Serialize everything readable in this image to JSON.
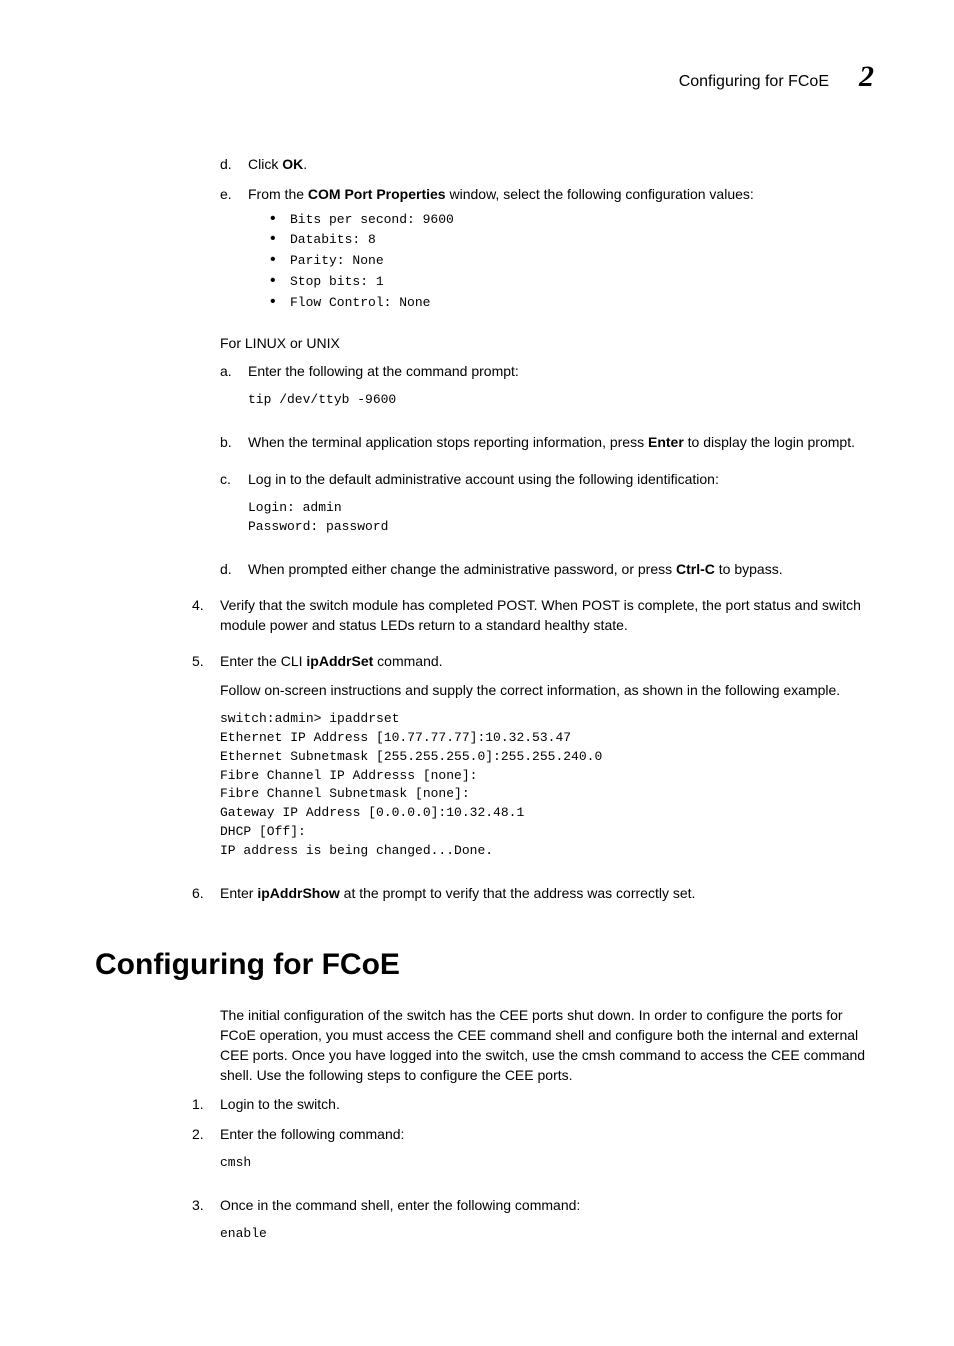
{
  "header": {
    "title": "Configuring for FCoE",
    "chapter": "2"
  },
  "sectionA": {
    "d_prefix": "d.",
    "d_text1": "Click ",
    "d_bold": "OK",
    "d_text2": ".",
    "e_prefix": "e.",
    "e_text1": "From the ",
    "e_bold": "COM Port Properties",
    "e_text2": " window, select the following configuration values:",
    "bullets": [
      "Bits per second: 9600",
      "Databits: 8",
      "Parity: None",
      "Stop bits: 1",
      "Flow Control: None"
    ],
    "linux_label": "For LINUX or UNIX",
    "a_prefix": "a.",
    "a_text": "Enter the following at the command prompt:",
    "a_code": "tip /dev/ttyb -9600",
    "b_prefix": "b.",
    "b_text1": "When the terminal application stops reporting information, press ",
    "b_bold": "Enter",
    "b_text2": " to display the login prompt.",
    "c_prefix": "c.",
    "c_text": "Log in to the default administrative account using the following identification:",
    "c_code": "Login: admin\nPassword: password",
    "d2_prefix": "d.",
    "d2_text1": "When prompted either change the administrative password, or press ",
    "d2_bold": "Ctrl-C",
    "d2_text2": " to bypass.",
    "s4_prefix": "4.",
    "s4_text": "Verify that the switch module has completed POST. When POST is complete, the port status and switch module power and status LEDs return to a standard healthy state.",
    "s5_prefix": "5.",
    "s5_text1": "Enter the CLI ",
    "s5_bold": "ipAddrSet",
    "s5_text2": " command.",
    "s5_follow": "Follow on-screen instructions and supply the correct information, as shown in the following example.",
    "s5_code": "switch:admin> ipaddrset\nEthernet IP Address [10.77.77.77]:10.32.53.47\nEthernet Subnetmask [255.255.255.0]:255.255.240.0\nFibre Channel IP Addresss [none]:\nFibre Channel Subnetmask [none]:\nGateway IP Address [0.0.0.0]:10.32.48.1\nDHCP [Off]:\nIP address is being changed...Done.",
    "s6_prefix": "6.",
    "s6_text1": "Enter ",
    "s6_bold": "ipAddrShow",
    "s6_text2": " at the prompt to verify that the address was correctly set."
  },
  "sectionB": {
    "heading": "Configuring for FCoE",
    "intro": "The initial configuration of the switch has the CEE ports shut down. In order to configure the ports for FCoE operation, you must access the CEE command shell and configure both the internal and external CEE ports. Once you have logged into the switch, use the cmsh command to access the CEE command shell. Use the following steps to configure the CEE ports.",
    "s1_prefix": "1.",
    "s1_text": "Login to the switch.",
    "s2_prefix": "2.",
    "s2_text": "Enter the following command:",
    "s2_code": "cmsh",
    "s3_prefix": "3.",
    "s3_text": "Once in the command shell, enter the following command:",
    "s3_code": "enable"
  }
}
